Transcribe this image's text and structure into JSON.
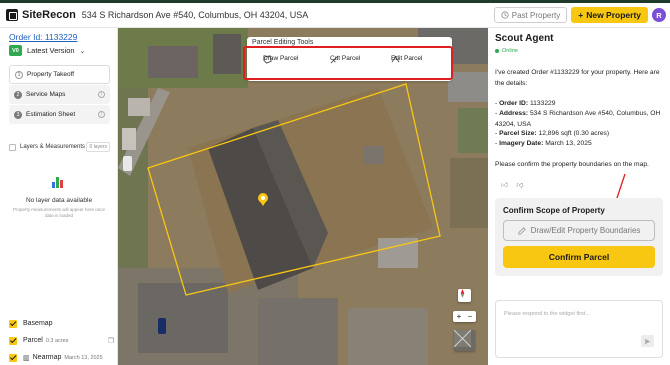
{
  "header": {
    "brand": "SiteRecon",
    "address": "534 S Richardson Ave #540, Columbus, OH 43204, USA",
    "past_property_label": "Past Property",
    "new_property_label": "New Property",
    "avatar_initial": "R",
    "icons": {
      "past": "history-icon",
      "new": "plus-icon"
    }
  },
  "sidebar": {
    "order_id": "Order Id: 1133229",
    "version_badge": "V0",
    "version_label": "Latest Version",
    "steps": [
      {
        "num": "1",
        "label": "Property Takeoff",
        "active": true
      },
      {
        "num": "2",
        "label": "Service Maps",
        "active": false
      },
      {
        "num": "3",
        "label": "Estimation Sheet",
        "active": false
      }
    ],
    "layers_label": "Layers & Measurements",
    "layers_count": "0 layers",
    "no_layer_title": "No layer data available",
    "no_layer_desc": "Property measurements will appear here once data is loaded",
    "bottom_layers": [
      {
        "label": "Basemap",
        "sub": ""
      },
      {
        "label": "Parcel",
        "sub": "0.3 acres"
      },
      {
        "label": "Nearmap",
        "sub": "March 13, 2025"
      }
    ]
  },
  "map": {
    "tools_title": "Parcel Editing Tools",
    "tools": [
      {
        "label": "Draw Parcel",
        "icon": "polygon-icon"
      },
      {
        "label": "Cut Parcel",
        "icon": "cut-icon"
      },
      {
        "label": "Edit Parcel",
        "icon": "edit-vertex-icon"
      }
    ],
    "zoom_in": "+",
    "zoom_out": "−",
    "colors": {
      "parcel_outline": "#f8c712",
      "highlight": "#e02020",
      "pin": "#f8c712"
    }
  },
  "chat": {
    "title": "Scout Agent",
    "status": "Online",
    "intro": "I've created Order #1133229 for your property. Here are the details:",
    "details": [
      {
        "label": "Order ID:",
        "value": "1133229"
      },
      {
        "label": "Address:",
        "value": "534 S Richardson Ave #540, Columbus, OH 43204, USA"
      },
      {
        "label": "Parcel Size:",
        "value": "12,896 sqft (0.30 acres)"
      },
      {
        "label": "Imagery Date:",
        "value": "March 13, 2025"
      }
    ],
    "closing": "Please confirm the property boundaries on the map.",
    "confirm_title": "Confirm Scope of Property",
    "draw_button": "Draw/Edit Property Boundaries",
    "confirm_button": "Confirm Parcel",
    "input_placeholder": "Please respond to the widget first..."
  }
}
